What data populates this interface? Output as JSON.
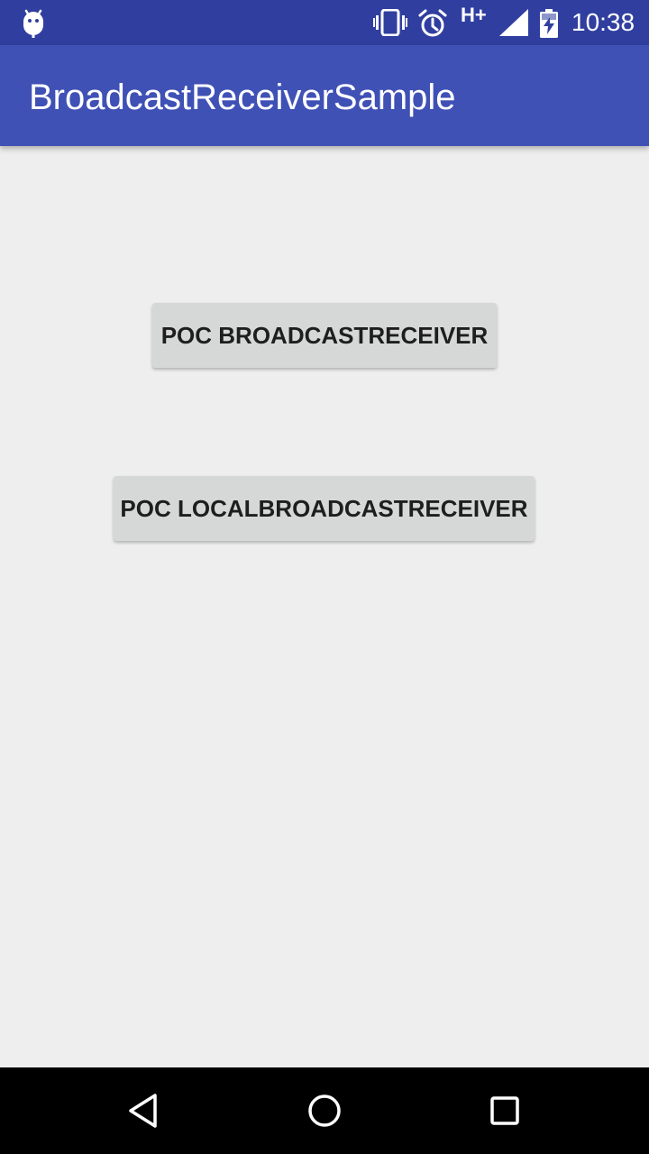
{
  "status_bar": {
    "time": "10:38",
    "network": "H+",
    "icons": [
      "android-notification-icon",
      "vibrate-icon",
      "alarm-icon",
      "signal-icon",
      "battery-charging-icon"
    ]
  },
  "app_bar": {
    "title": "BroadcastReceiverSample",
    "color": "#3f51b5",
    "status_color": "#303f9f"
  },
  "main": {
    "buttons": [
      {
        "label": "POC BROADCASTRECEIVER"
      },
      {
        "label": "POC LOCALBROADCASTRECEIVER"
      }
    ]
  },
  "nav_bar": {
    "icons": [
      "back-icon",
      "home-icon",
      "recents-icon"
    ]
  }
}
